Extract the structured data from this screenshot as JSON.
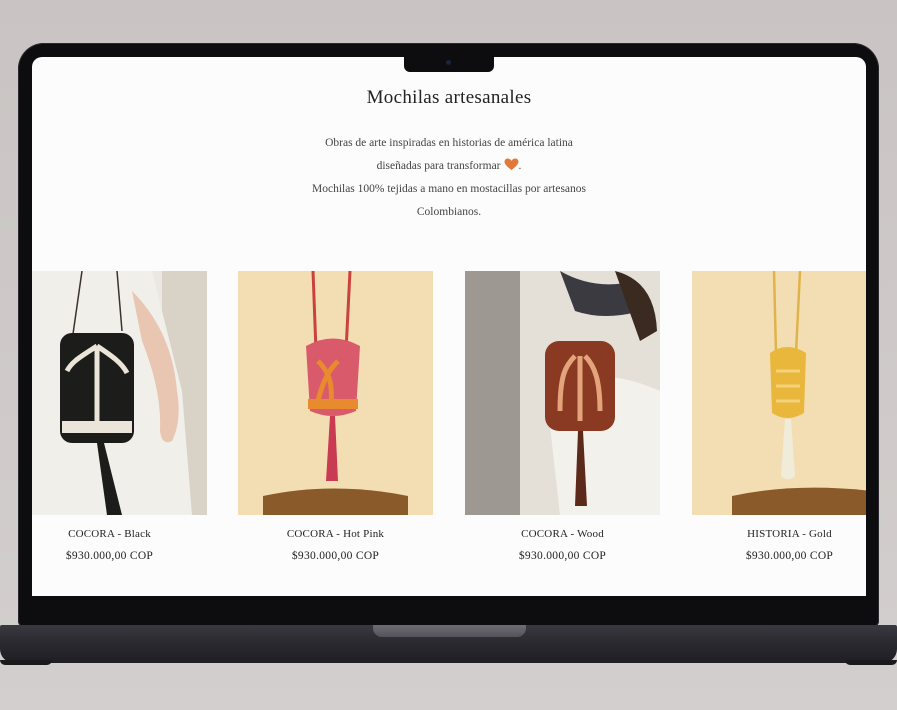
{
  "section": {
    "title": "Mochilas artesanales",
    "intro_lines": [
      "Obras de arte inspiradas en historias de américa latina",
      "diseñadas para transformar",
      "Mochilas 100% tejidas a mano en mostacillas por artesanos",
      "Colombianos."
    ],
    "heart_icon": "orange-heart-icon"
  },
  "products": [
    {
      "name": "COCORA - Black",
      "price": "$930.000,00 COP"
    },
    {
      "name": "COCORA - Hot Pink",
      "price": "$930.000,00 COP"
    },
    {
      "name": "COCORA - Wood",
      "price": "$930.000,00 COP"
    },
    {
      "name": "HISTORIA - Gold",
      "price": "$930.000,00 COP"
    }
  ],
  "colors": {
    "accent_heart": "#e07a3a",
    "background": "#fcfcfc",
    "text": "#222222"
  }
}
